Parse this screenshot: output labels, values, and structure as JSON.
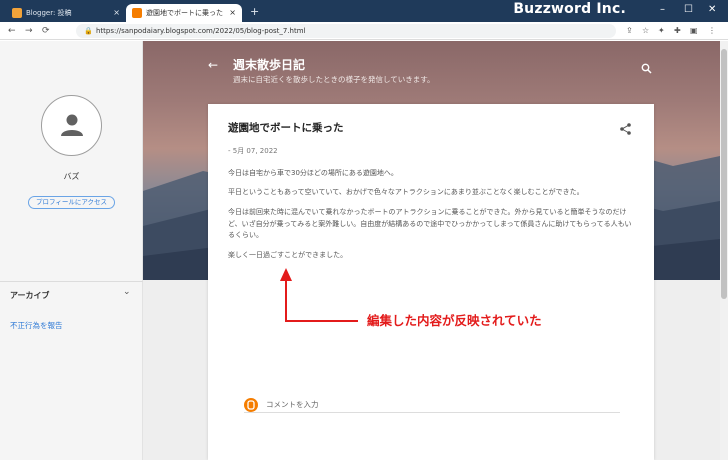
{
  "browser": {
    "tabs": [
      {
        "label": "Blogger: 投稿",
        "active": false
      },
      {
        "label": "遊園地でボートに乗った",
        "active": true
      }
    ],
    "tab_close": "×",
    "new_tab": "+",
    "brand": "Buzzword Inc.",
    "window_buttons": {
      "minimize": "–",
      "maximize": "☐",
      "close": "✕"
    },
    "nav": {
      "back": "←",
      "forward": "→",
      "reload": "⟳"
    },
    "url": "https://sanpodaiary.blogspot.com/2022/05/blog-post_7.html",
    "right_icons": {
      "share": "⇪",
      "star": "☆",
      "extension": "✦",
      "puzzle": "✚",
      "profile": "▣",
      "menu": "⋮"
    }
  },
  "sidebar": {
    "profile_name": "バズ",
    "profile_button": "プロフィールにアクセス",
    "archive_label": "アーカイブ",
    "archive_chevron": "⌄",
    "report_link": "不正行為を報告"
  },
  "header": {
    "back": "←",
    "title": "週末散歩日記",
    "description": "週末に自宅近くを散歩したときの様子を発信していきます。"
  },
  "post": {
    "title": "遊園地でボートに乗った",
    "date": "- 5月 07, 2022",
    "paragraphs": [
      "今日は自宅から車で30分ほどの場所にある遊園地へ。",
      "平日ということもあって空いていて、おかげで色々なアトラクションにあまり並ぶことなく楽しむことができた。",
      "今日は前回来た時に混んでいて乗れなかったボートのアトラクションに乗ることができた。外から見ていると簡単そうなのだけど、いざ自分が乗ってみると案外難しい。自由度が結構あるので途中でひっかかってしまって係員さんに助けてもらってる人もいるくらい。",
      "楽しく一日過ごすことができました。"
    ],
    "comment_placeholder": "コメントを入力"
  },
  "annotation": {
    "text": "編集した内容が反映されていた",
    "color": "#e31b1b"
  }
}
